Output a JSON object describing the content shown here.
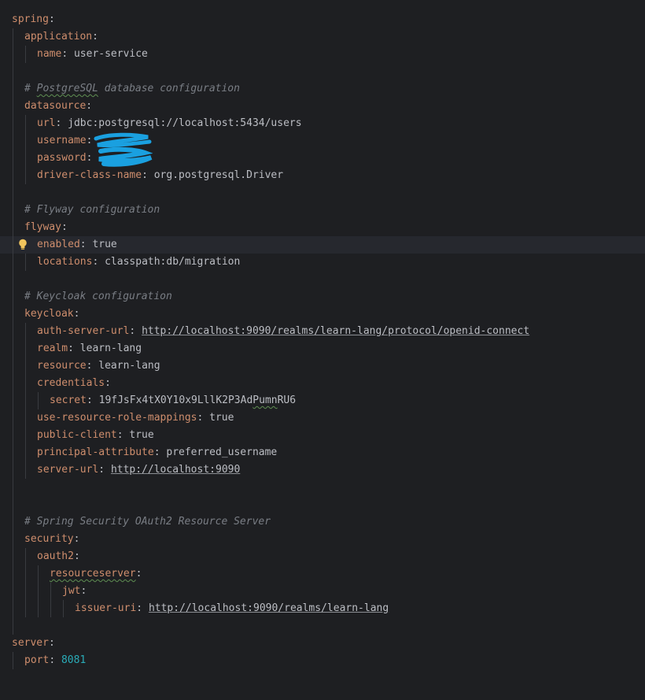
{
  "editor": {
    "lines": [
      [
        {
          "t": "spring",
          "c": "k"
        },
        {
          "t": ":",
          "c": "p"
        }
      ],
      [
        {
          "t": "application",
          "c": "k"
        },
        {
          "t": ":",
          "c": "p"
        }
      ],
      [
        {
          "t": "name",
          "c": "k"
        },
        {
          "t": ": ",
          "c": "p"
        },
        {
          "t": "user-service",
          "c": "v"
        }
      ],
      [],
      [
        {
          "t": "# ",
          "c": "c"
        },
        {
          "t": "PostgreSQL",
          "c": "c squig"
        },
        {
          "t": " database configuration",
          "c": "c"
        }
      ],
      [
        {
          "t": "datasource",
          "c": "k"
        },
        {
          "t": ":",
          "c": "p"
        }
      ],
      [
        {
          "t": "url",
          "c": "k"
        },
        {
          "t": ": ",
          "c": "p"
        },
        {
          "t": "jdbc:postgresql://localhost:5434/users",
          "c": "v"
        }
      ],
      [
        {
          "t": "username",
          "c": "k"
        },
        {
          "t": ":",
          "c": "p"
        }
      ],
      [
        {
          "t": "password",
          "c": "k"
        },
        {
          "t": ":",
          "c": "p"
        }
      ],
      [
        {
          "t": "driver-class-name",
          "c": "k"
        },
        {
          "t": ": ",
          "c": "p"
        },
        {
          "t": "org.postgresql.Driver",
          "c": "v"
        }
      ],
      [],
      [
        {
          "t": "# Flyway configuration",
          "c": "c"
        }
      ],
      [
        {
          "t": "flyway",
          "c": "k"
        },
        {
          "t": ":",
          "c": "p"
        }
      ],
      [
        {
          "t": "enabled",
          "c": "k"
        },
        {
          "t": ": ",
          "c": "p"
        },
        {
          "t": "true",
          "c": "v"
        }
      ],
      [
        {
          "t": "locations",
          "c": "k"
        },
        {
          "t": ": ",
          "c": "p"
        },
        {
          "t": "classpath:db/migration",
          "c": "v"
        }
      ],
      [],
      [
        {
          "t": "# Keycloak configuration",
          "c": "c"
        }
      ],
      [
        {
          "t": "keycloak",
          "c": "k"
        },
        {
          "t": ":",
          "c": "p"
        }
      ],
      [
        {
          "t": "auth-server-url",
          "c": "k"
        },
        {
          "t": ": ",
          "c": "p"
        },
        {
          "t": "http://localhost:9090/realms/learn-lang/protocol/openid-connect",
          "c": "v u"
        }
      ],
      [
        {
          "t": "realm",
          "c": "k"
        },
        {
          "t": ": ",
          "c": "p"
        },
        {
          "t": "learn-lang",
          "c": "v"
        }
      ],
      [
        {
          "t": "resource",
          "c": "k"
        },
        {
          "t": ": ",
          "c": "p"
        },
        {
          "t": "learn-lang",
          "c": "v"
        }
      ],
      [
        {
          "t": "credentials",
          "c": "k"
        },
        {
          "t": ":",
          "c": "p"
        }
      ],
      [
        {
          "t": "secret",
          "c": "k"
        },
        {
          "t": ": ",
          "c": "p"
        },
        {
          "t": "19fJsFx4tX0Y10x9LllK2P3Ad",
          "c": "v"
        },
        {
          "t": "Pumn",
          "c": "v squig"
        },
        {
          "t": "RU6",
          "c": "v"
        }
      ],
      [
        {
          "t": "use-resource-role-mappings",
          "c": "k"
        },
        {
          "t": ": ",
          "c": "p"
        },
        {
          "t": "true",
          "c": "v"
        }
      ],
      [
        {
          "t": "public-client",
          "c": "k"
        },
        {
          "t": ": ",
          "c": "p"
        },
        {
          "t": "true",
          "c": "v"
        }
      ],
      [
        {
          "t": "principal-attribute",
          "c": "k"
        },
        {
          "t": ": ",
          "c": "p"
        },
        {
          "t": "preferred_username",
          "c": "v"
        }
      ],
      [
        {
          "t": "server-url",
          "c": "k"
        },
        {
          "t": ": ",
          "c": "p"
        },
        {
          "t": "http://localhost:9090",
          "c": "v u"
        }
      ],
      [],
      [],
      [
        {
          "t": "# Spring Security OAuth2 Resource Server",
          "c": "c"
        }
      ],
      [
        {
          "t": "security",
          "c": "k"
        },
        {
          "t": ":",
          "c": "p"
        }
      ],
      [
        {
          "t": "oauth2",
          "c": "k"
        },
        {
          "t": ":",
          "c": "p"
        }
      ],
      [
        {
          "t": "resourceserver",
          "c": "k squig"
        },
        {
          "t": ":",
          "c": "p"
        }
      ],
      [
        {
          "t": "jwt",
          "c": "k"
        },
        {
          "t": ":",
          "c": "p"
        }
      ],
      [
        {
          "t": "issuer-uri",
          "c": "k"
        },
        {
          "t": ": ",
          "c": "p"
        },
        {
          "t": "http://localhost:9090/realms/learn-lang",
          "c": "v u"
        }
      ],
      [],
      [
        {
          "t": "server",
          "c": "k"
        },
        {
          "t": ":",
          "c": "p"
        }
      ],
      [
        {
          "t": "port",
          "c": "k"
        },
        {
          "t": ": ",
          "c": "p"
        },
        {
          "t": "8081",
          "c": "n"
        }
      ]
    ]
  }
}
